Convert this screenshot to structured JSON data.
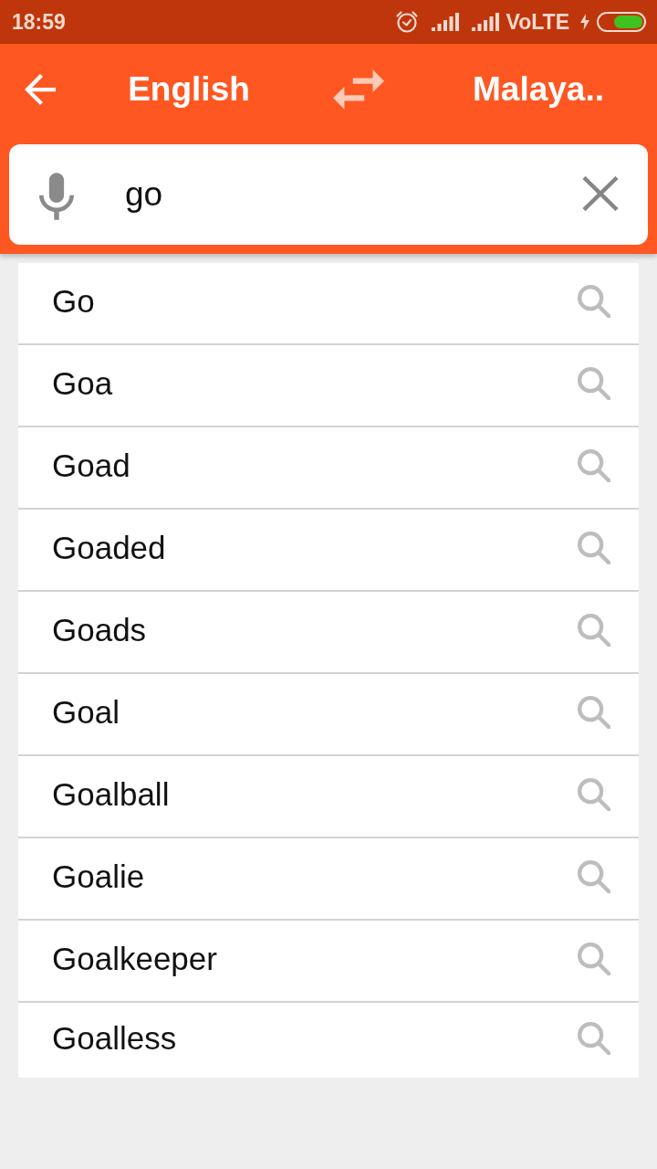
{
  "status_bar": {
    "time": "18:59",
    "network": "VoLTE"
  },
  "header": {
    "source_language": "English",
    "target_language": "Malaya.."
  },
  "search": {
    "value": "go"
  },
  "suggestions": [
    "Go",
    "Goa",
    "Goad",
    "Goaded",
    "Goads",
    "Goal",
    "Goalball",
    "Goalie",
    "Goalkeeper",
    "Goalless"
  ]
}
